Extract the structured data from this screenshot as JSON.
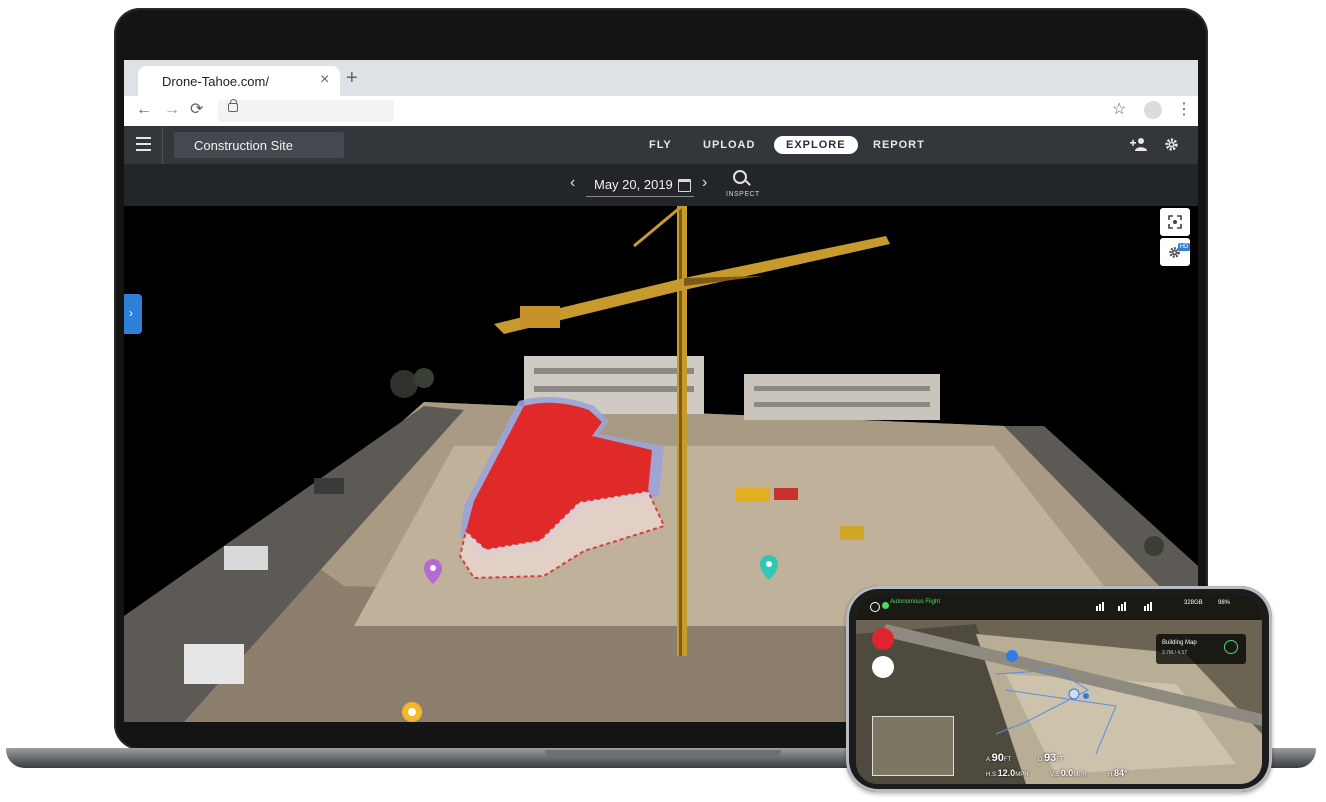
{
  "browser": {
    "tab_title": "Drone-Tahoe.com/",
    "tab_close": "×",
    "new_tab": "+",
    "back": "←",
    "forward": "→",
    "reload": "⟳",
    "star": "☆",
    "menu": "⋮"
  },
  "app": {
    "site_name": "Construction Site",
    "tabs": [
      {
        "label": "FLY",
        "active": false
      },
      {
        "label": "UPLOAD",
        "active": false
      },
      {
        "label": "EXPLORE",
        "active": true
      },
      {
        "label": "REPORT",
        "active": false
      }
    ],
    "date": "May 20, 2019",
    "date_prev": "‹",
    "date_next": "›",
    "inspect_label": "INSPECT",
    "side_tab_arrow": "›",
    "hd_badge": "HD",
    "icons": [
      "menu-icon",
      "add-user-icon",
      "gear-icon",
      "calendar-icon",
      "inspect-icon",
      "fullscreen-icon",
      "settings-hd-icon"
    ],
    "colors": {
      "header": "#33363b",
      "datebar": "#22252a",
      "accent": "#2f80d8",
      "volume": "#e02a2a"
    }
  },
  "phone": {
    "flight_status": "Autonomous Flight",
    "storage": "328GB",
    "battery": "98%",
    "panel_title": "Building Map",
    "panel_sub": "3.7M / 4.57",
    "altitude_label": "A:",
    "altitude": "90",
    "distance_label": "D:",
    "distance": "93",
    "hspeed_label": "H.S:",
    "hspeed": "12.0",
    "vspeed_label": "V.S:",
    "vspeed": "0.0",
    "heading_label": "H:",
    "heading": "84°",
    "unit_ft": "FT",
    "unit_mph": "MPH"
  }
}
